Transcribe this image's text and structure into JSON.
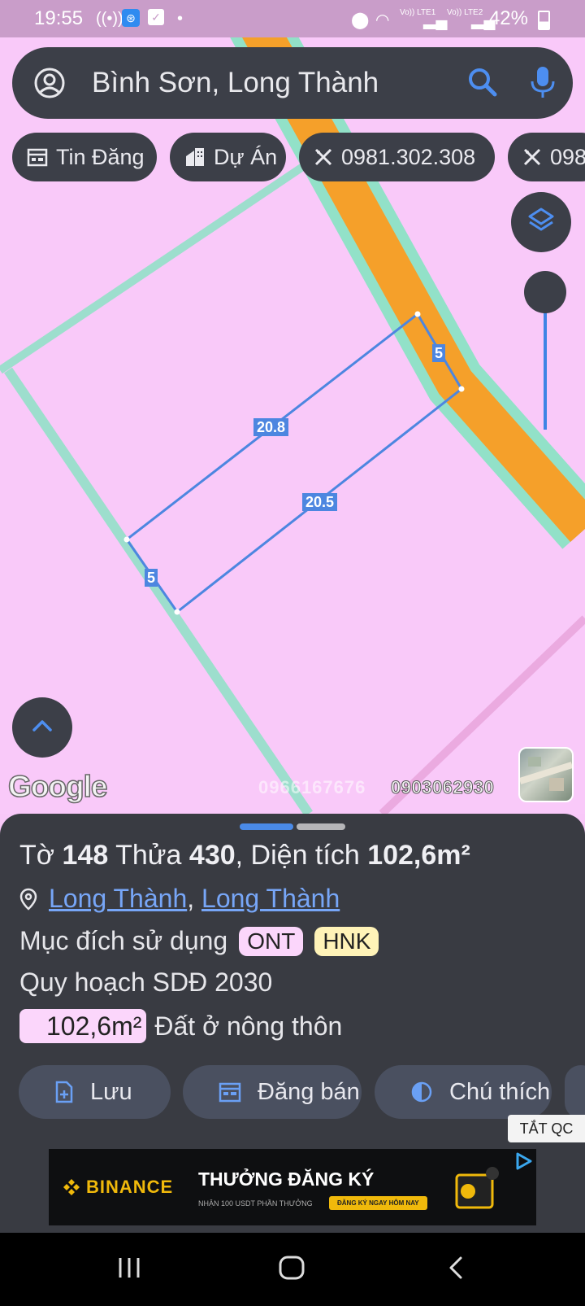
{
  "status_bar": {
    "time": "19:55",
    "sim1": "Vo)) LTE1",
    "sim2": "Vo)) LTE2",
    "battery": "42%"
  },
  "search": {
    "query": "Bình Sơn, Long Thành"
  },
  "chips": [
    {
      "label": "Tin Đăng",
      "icon": "calendar-icon"
    },
    {
      "label": "Dự Án",
      "icon": "building-icon"
    },
    {
      "label": "0981.302.308",
      "icon": "ruler-pencil-icon"
    },
    {
      "label": "098",
      "icon": "ruler-pencil-icon"
    }
  ],
  "map": {
    "edge_labels": {
      "top": "20.8",
      "bottom": "20.5",
      "right": "5",
      "left": "5"
    },
    "watermark_left": "0966167676",
    "watermark_right": "0903062930",
    "google": "Google",
    "colors": {
      "land": "#f9c9f9",
      "road": "#f5a02a",
      "road_edge": "#86e3c2",
      "plot_line": "#4d86e0"
    }
  },
  "parcel": {
    "title_prefix": "Tờ",
    "sheet_no": "148",
    "plot_word": "Thửa",
    "plot_no": "430",
    "area_word": ", Diện tích",
    "area": "102,6m²",
    "ward": "Long Thành",
    "district": "Long Thành",
    "purpose_label": "Mục đích sử dụng",
    "purpose_codes": [
      {
        "code": "ONT",
        "color": "#fbd6fb"
      },
      {
        "code": "HNK",
        "color": "#fff3b8"
      }
    ],
    "plan_label": "Quy hoạch SDĐ 2030",
    "plan_area": "102,6m²",
    "plan_type": "Đất ở nông thôn"
  },
  "actions": [
    {
      "label": "Lưu",
      "icon": "save-doc-icon"
    },
    {
      "label": "Đăng bán",
      "icon": "listing-icon"
    },
    {
      "label": "Chú thích",
      "icon": "contrast-icon"
    }
  ],
  "ad": {
    "close_label": "TẮT QC",
    "brand": "BINANCE",
    "headline": "THƯỞNG ĐĂNG KÝ",
    "subline": "NHẬN 100 USDT PHẦN THƯỞNG",
    "cta": "ĐĂNG KÝ NGAY HÔM NAY"
  }
}
